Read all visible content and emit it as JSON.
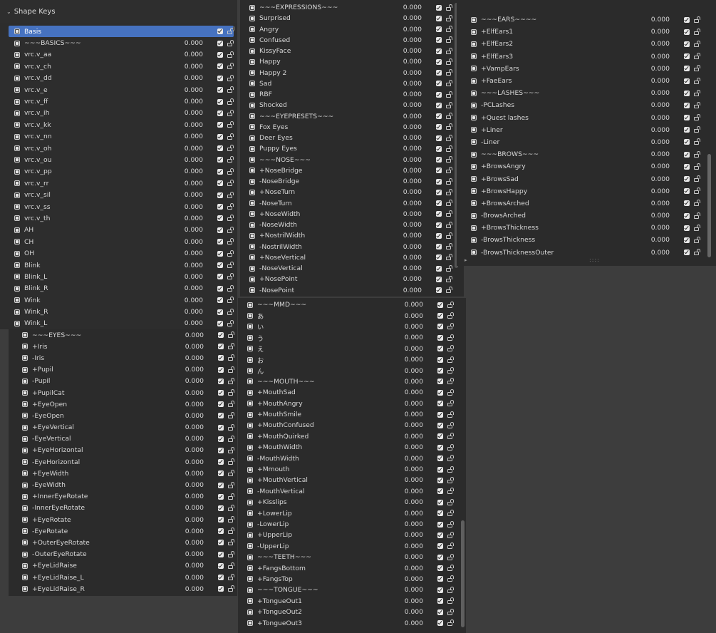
{
  "panel1": {
    "title": "Shape Keys",
    "items": [
      {
        "name": "Basis",
        "value": "",
        "selected": true
      },
      {
        "name": "~~~BASICS~~~",
        "value": "0.000"
      },
      {
        "name": "vrc.v_aa",
        "value": "0.000"
      },
      {
        "name": "vrc.v_ch",
        "value": "0.000"
      },
      {
        "name": "vrc.v_dd",
        "value": "0.000"
      },
      {
        "name": "vrc.v_e",
        "value": "0.000"
      },
      {
        "name": "vrc.v_ff",
        "value": "0.000"
      },
      {
        "name": "vrc.v_ih",
        "value": "0.000"
      },
      {
        "name": "vrc.v_kk",
        "value": "0.000"
      },
      {
        "name": "vrc.v_nn",
        "value": "0.000"
      },
      {
        "name": "vrc.v_oh",
        "value": "0.000"
      },
      {
        "name": "vrc.v_ou",
        "value": "0.000"
      },
      {
        "name": "vrc.v_pp",
        "value": "0.000"
      },
      {
        "name": "vrc.v_rr",
        "value": "0.000"
      },
      {
        "name": "vrc.v_sil",
        "value": "0.000"
      },
      {
        "name": "vrc.v_ss",
        "value": "0.000"
      },
      {
        "name": "vrc.v_th",
        "value": "0.000"
      },
      {
        "name": "AH",
        "value": "0.000"
      },
      {
        "name": "CH",
        "value": "0.000"
      },
      {
        "name": "OH",
        "value": "0.000"
      },
      {
        "name": "Blink",
        "value": "0.000"
      },
      {
        "name": "Blink_L",
        "value": "0.000"
      },
      {
        "name": "Blink_R",
        "value": "0.000"
      },
      {
        "name": "Wink",
        "value": "0.000"
      },
      {
        "name": "Wink_R",
        "value": "0.000"
      },
      {
        "name": "Wink_L",
        "value": "0.000"
      }
    ]
  },
  "panel2": {
    "items": [
      {
        "name": "~~~EYES~~~",
        "value": "0.000"
      },
      {
        "name": "+Iris",
        "value": "0.000"
      },
      {
        "name": "-Iris",
        "value": "0.000"
      },
      {
        "name": "+Pupil",
        "value": "0.000"
      },
      {
        "name": "-Pupil",
        "value": "0.000"
      },
      {
        "name": "+PupilCat",
        "value": "0.000"
      },
      {
        "name": "+EyeOpen",
        "value": "0.000"
      },
      {
        "name": "-EyeOpen",
        "value": "0.000"
      },
      {
        "name": "+EyeVertical",
        "value": "0.000"
      },
      {
        "name": "-EyeVertical",
        "value": "0.000"
      },
      {
        "name": "+EyeHorizontal",
        "value": "0.000"
      },
      {
        "name": "-EyeHorizontal",
        "value": "0.000"
      },
      {
        "name": "+EyeWidth",
        "value": "0.000"
      },
      {
        "name": "-EyeWidth",
        "value": "0.000"
      },
      {
        "name": "+InnerEyeRotate",
        "value": "0.000"
      },
      {
        "name": "-InnerEyeRotate",
        "value": "0.000"
      },
      {
        "name": "+EyeRotate",
        "value": "0.000"
      },
      {
        "name": "-EyeRotate",
        "value": "0.000"
      },
      {
        "name": "+OuterEyeRotate",
        "value": "0.000"
      },
      {
        "name": "-OuterEyeRotate",
        "value": "0.000"
      },
      {
        "name": "+EyeLidRaise",
        "value": "0.000"
      },
      {
        "name": "+EyeLidRaise_L",
        "value": "0.000"
      },
      {
        "name": "+EyeLidRaise_R",
        "value": "0.000"
      }
    ]
  },
  "panel3": {
    "items": [
      {
        "name": "~~~EXPRESSIONS~~~",
        "value": "0.000"
      },
      {
        "name": "Surprised",
        "value": "0.000"
      },
      {
        "name": "Angry",
        "value": "0.000"
      },
      {
        "name": "Confused",
        "value": "0.000"
      },
      {
        "name": "KissyFace",
        "value": "0.000"
      },
      {
        "name": "Happy",
        "value": "0.000"
      },
      {
        "name": "Happy 2",
        "value": "0.000"
      },
      {
        "name": "Sad",
        "value": "0.000"
      },
      {
        "name": "RBF",
        "value": "0.000"
      },
      {
        "name": "Shocked",
        "value": "0.000"
      },
      {
        "name": "~~~EYEPRESETS~~~",
        "value": "0.000"
      },
      {
        "name": "Fox Eyes",
        "value": "0.000"
      },
      {
        "name": "Deer Eyes",
        "value": "0.000"
      },
      {
        "name": "Puppy Eyes",
        "value": "0.000"
      },
      {
        "name": "~~~NOSE~~~",
        "value": "0.000"
      },
      {
        "name": "+NoseBridge",
        "value": "0.000"
      },
      {
        "name": "-NoseBridge",
        "value": "0.000"
      },
      {
        "name": "+NoseTurn",
        "value": "0.000"
      },
      {
        "name": "-NoseTurn",
        "value": "0.000"
      },
      {
        "name": "+NoseWidth",
        "value": "0.000"
      },
      {
        "name": "-NoseWidth",
        "value": "0.000"
      },
      {
        "name": "+NostrilWidth",
        "value": "0.000"
      },
      {
        "name": "-NostrilWidth",
        "value": "0.000"
      },
      {
        "name": "+NoseVertical",
        "value": "0.000"
      },
      {
        "name": "-NoseVertical",
        "value": "0.000"
      },
      {
        "name": "+NosePoint",
        "value": "0.000"
      },
      {
        "name": "-NosePoint",
        "value": "0.000"
      }
    ]
  },
  "panel4": {
    "items": [
      {
        "name": "~~~MMD~~~",
        "value": "0.000"
      },
      {
        "name": "あ",
        "value": "0.000"
      },
      {
        "name": "い",
        "value": "0.000"
      },
      {
        "name": "う",
        "value": "0.000"
      },
      {
        "name": "え",
        "value": "0.000"
      },
      {
        "name": "お",
        "value": "0.000"
      },
      {
        "name": "ん",
        "value": "0.000"
      },
      {
        "name": "~~~MOUTH~~~",
        "value": "0.000"
      },
      {
        "name": "+MouthSad",
        "value": "0.000"
      },
      {
        "name": "+MouthAngry",
        "value": "0.000"
      },
      {
        "name": "+MouthSmile",
        "value": "0.000"
      },
      {
        "name": "+MouthConfused",
        "value": "0.000"
      },
      {
        "name": "+MouthQuirked",
        "value": "0.000"
      },
      {
        "name": "+MouthWidth",
        "value": "0.000"
      },
      {
        "name": "-MouthWidth",
        "value": "0.000"
      },
      {
        "name": "+Mmouth",
        "value": "0.000"
      },
      {
        "name": "+MouthVertical",
        "value": "0.000"
      },
      {
        "name": "-MouthVertical",
        "value": "0.000"
      },
      {
        "name": "+Kisslips",
        "value": "0.000"
      },
      {
        "name": "+LowerLip",
        "value": "0.000"
      },
      {
        "name": "-LowerLip",
        "value": "0.000"
      },
      {
        "name": "+UpperLip",
        "value": "0.000"
      },
      {
        "name": "-UpperLip",
        "value": "0.000"
      },
      {
        "name": "~~~TEETH~~~",
        "value": "0.000"
      },
      {
        "name": "+FangsBottom",
        "value": "0.000"
      },
      {
        "name": "+FangsTop",
        "value": "0.000"
      },
      {
        "name": "~~~TONGUE~~~",
        "value": "0.000"
      },
      {
        "name": "+TongueOut1",
        "value": "0.000"
      },
      {
        "name": "+TongueOut2",
        "value": "0.000"
      },
      {
        "name": "+TongueOut3",
        "value": "0.000"
      }
    ]
  },
  "panel5": {
    "items": [
      {
        "name": "~~~EARS~~~~",
        "value": "0.000"
      },
      {
        "name": "+ElfEars1",
        "value": "0.000"
      },
      {
        "name": "+ElfEars2",
        "value": "0.000"
      },
      {
        "name": "+ElfEars3",
        "value": "0.000"
      },
      {
        "name": "+VampEars",
        "value": "0.000"
      },
      {
        "name": "+FaeEars",
        "value": "0.000"
      },
      {
        "name": "~~~LASHES~~~",
        "value": "0.000"
      },
      {
        "name": "-PCLashes",
        "value": "0.000"
      },
      {
        "name": "+Quest lashes",
        "value": "0.000"
      },
      {
        "name": "+Liner",
        "value": "0.000"
      },
      {
        "name": "-Liner",
        "value": "0.000"
      },
      {
        "name": "~~~BROWS~~~",
        "value": "0.000"
      },
      {
        "name": "+BrowsAngry",
        "value": "0.000"
      },
      {
        "name": "+BrowsSad",
        "value": "0.000"
      },
      {
        "name": "+BrowsHappy",
        "value": "0.000"
      },
      {
        "name": "+BrowsArched",
        "value": "0.000"
      },
      {
        "name": "-BrowsArched",
        "value": "0.000"
      },
      {
        "name": "+BrowsThickness",
        "value": "0.000"
      },
      {
        "name": "-BrowsThickness",
        "value": "0.000"
      },
      {
        "name": "-BrowsThicknessOuter",
        "value": "0.000"
      }
    ]
  },
  "icons": {
    "shape_key": "shape-key-icon",
    "checkbox": "checkbox-icon",
    "lock": "lock-open-icon",
    "collapse": "chevron-down-icon"
  },
  "glyphs": {
    "chevron": "⌄",
    "grip": "::::",
    "corner": "▸"
  }
}
